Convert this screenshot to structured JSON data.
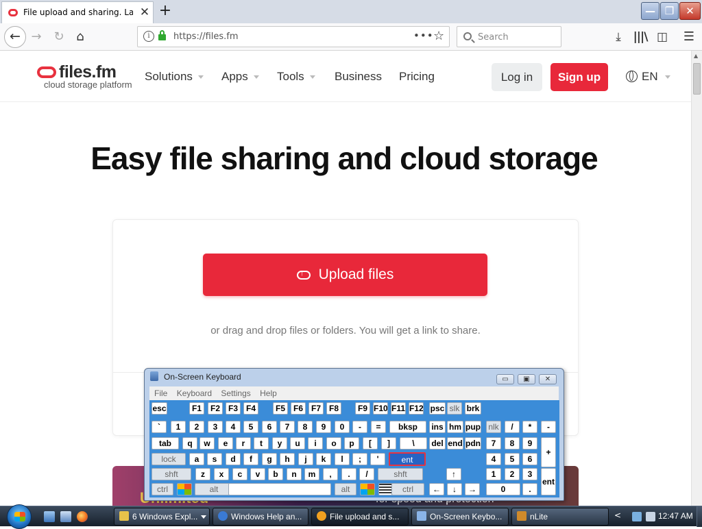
{
  "browser": {
    "tab_title": "File upload and sharing. Large file transfer",
    "tab_close": "✕",
    "new_tab": "+",
    "window_buttons": {
      "minimize": "—",
      "maximize": "❐",
      "close": "✕"
    },
    "nav": {
      "back": "←",
      "forward": "→",
      "reload": "↻",
      "home": "⌂"
    },
    "url": "https://files.fm",
    "url_info": "i",
    "page_actions": "•••",
    "bookmark_star": "☆",
    "search_placeholder": "Search",
    "toolbar_icons": {
      "downloads": "⤓",
      "library": "|||\\",
      "sidebar": "◫",
      "menu": "☰"
    }
  },
  "site": {
    "logo_name": "files.fm",
    "logo_tagline": "cloud storage platform",
    "menu": {
      "solutions": "Solutions",
      "apps": "Apps",
      "tools": "Tools",
      "business": "Business",
      "pricing": "Pricing"
    },
    "login": "Log in",
    "signup": "Sign up",
    "language": "EN",
    "hero_title": "Easy file sharing and cloud storage",
    "upload_button": "Upload files",
    "drop_hint": "or drag and drop files or folders. You will get a link to share.",
    "banner_left": "Unlimited",
    "banner_right": "for speed and protection"
  },
  "osk": {
    "title": "On-Screen Keyboard",
    "window_buttons": {
      "minimize": "▭",
      "maximize": "▣",
      "close": "✕"
    },
    "menu": [
      "File",
      "Keyboard",
      "Settings",
      "Help"
    ],
    "keys": [
      {
        "label": "esc"
      },
      {
        "label": "F1"
      },
      {
        "label": "F2"
      },
      {
        "label": "F3"
      },
      {
        "label": "F4"
      },
      {
        "label": "F5"
      },
      {
        "label": "F6"
      },
      {
        "label": "F7"
      },
      {
        "label": "F8"
      },
      {
        "label": "F9"
      },
      {
        "label": "F10"
      },
      {
        "label": "F11"
      },
      {
        "label": "F12"
      },
      {
        "label": "psc"
      },
      {
        "label": "slk",
        "dim": true
      },
      {
        "label": "brk"
      },
      {
        "label": "`"
      },
      {
        "label": "1"
      },
      {
        "label": "2"
      },
      {
        "label": "3"
      },
      {
        "label": "4"
      },
      {
        "label": "5"
      },
      {
        "label": "6"
      },
      {
        "label": "7"
      },
      {
        "label": "8"
      },
      {
        "label": "9"
      },
      {
        "label": "0"
      },
      {
        "label": "-"
      },
      {
        "label": "="
      },
      {
        "label": "bksp"
      },
      {
        "label": "ins"
      },
      {
        "label": "hm"
      },
      {
        "label": "pup"
      },
      {
        "label": "nlk",
        "dim": true
      },
      {
        "label": "/"
      },
      {
        "label": "*"
      },
      {
        "label": "-"
      },
      {
        "label": "tab"
      },
      {
        "label": "q"
      },
      {
        "label": "w"
      },
      {
        "label": "e"
      },
      {
        "label": "r"
      },
      {
        "label": "t"
      },
      {
        "label": "y"
      },
      {
        "label": "u"
      },
      {
        "label": "i"
      },
      {
        "label": "o"
      },
      {
        "label": "p"
      },
      {
        "label": "["
      },
      {
        "label": "]"
      },
      {
        "label": "\\"
      },
      {
        "label": "del"
      },
      {
        "label": "end"
      },
      {
        "label": "pdn"
      },
      {
        "label": "7"
      },
      {
        "label": "8"
      },
      {
        "label": "9"
      },
      {
        "label": "+"
      },
      {
        "label": "lock",
        "dim": true
      },
      {
        "label": "a"
      },
      {
        "label": "s"
      },
      {
        "label": "d"
      },
      {
        "label": "f"
      },
      {
        "label": "g"
      },
      {
        "label": "h"
      },
      {
        "label": "j"
      },
      {
        "label": "k"
      },
      {
        "label": "l"
      },
      {
        "label": ";"
      },
      {
        "label": "'"
      },
      {
        "label": "ent",
        "active": true
      },
      {
        "label": "4"
      },
      {
        "label": "5"
      },
      {
        "label": "6"
      },
      {
        "label": "shft",
        "dim": true
      },
      {
        "label": "z"
      },
      {
        "label": "x"
      },
      {
        "label": "c"
      },
      {
        "label": "v"
      },
      {
        "label": "b"
      },
      {
        "label": "n"
      },
      {
        "label": "m"
      },
      {
        "label": ","
      },
      {
        "label": "."
      },
      {
        "label": "/"
      },
      {
        "label": "shft",
        "dim": true
      },
      {
        "label": "↑"
      },
      {
        "label": "1"
      },
      {
        "label": "2"
      },
      {
        "label": "3"
      },
      {
        "label": "ent"
      },
      {
        "label": "ctrl",
        "dim": true
      },
      {
        "label": "",
        "icon": "windows-logo"
      },
      {
        "label": "alt",
        "dim": true
      },
      {
        "label": ""
      },
      {
        "label": "alt",
        "dim": true
      },
      {
        "label": "",
        "icon": "windows-logo"
      },
      {
        "label": "",
        "icon": "menu"
      },
      {
        "label": "ctrl",
        "dim": true
      },
      {
        "label": "←"
      },
      {
        "label": "↓"
      },
      {
        "label": "→"
      },
      {
        "label": "0"
      },
      {
        "label": "."
      }
    ]
  },
  "taskbar": {
    "items": [
      {
        "label": "6 Windows Expl...",
        "name": "explorer"
      },
      {
        "label": "Windows Help an...",
        "name": "help"
      },
      {
        "label": "File upload and s...",
        "name": "firefox"
      },
      {
        "label": "On-Screen Keybo...",
        "name": "osk"
      },
      {
        "label": "nLite",
        "name": "nlite"
      }
    ],
    "tray_arrow": "<",
    "clock": "12:47 AM"
  },
  "colors": {
    "brand_red": "#e8283a",
    "osk_blue": "#3b8cd8",
    "active_key": "#2663c4"
  }
}
